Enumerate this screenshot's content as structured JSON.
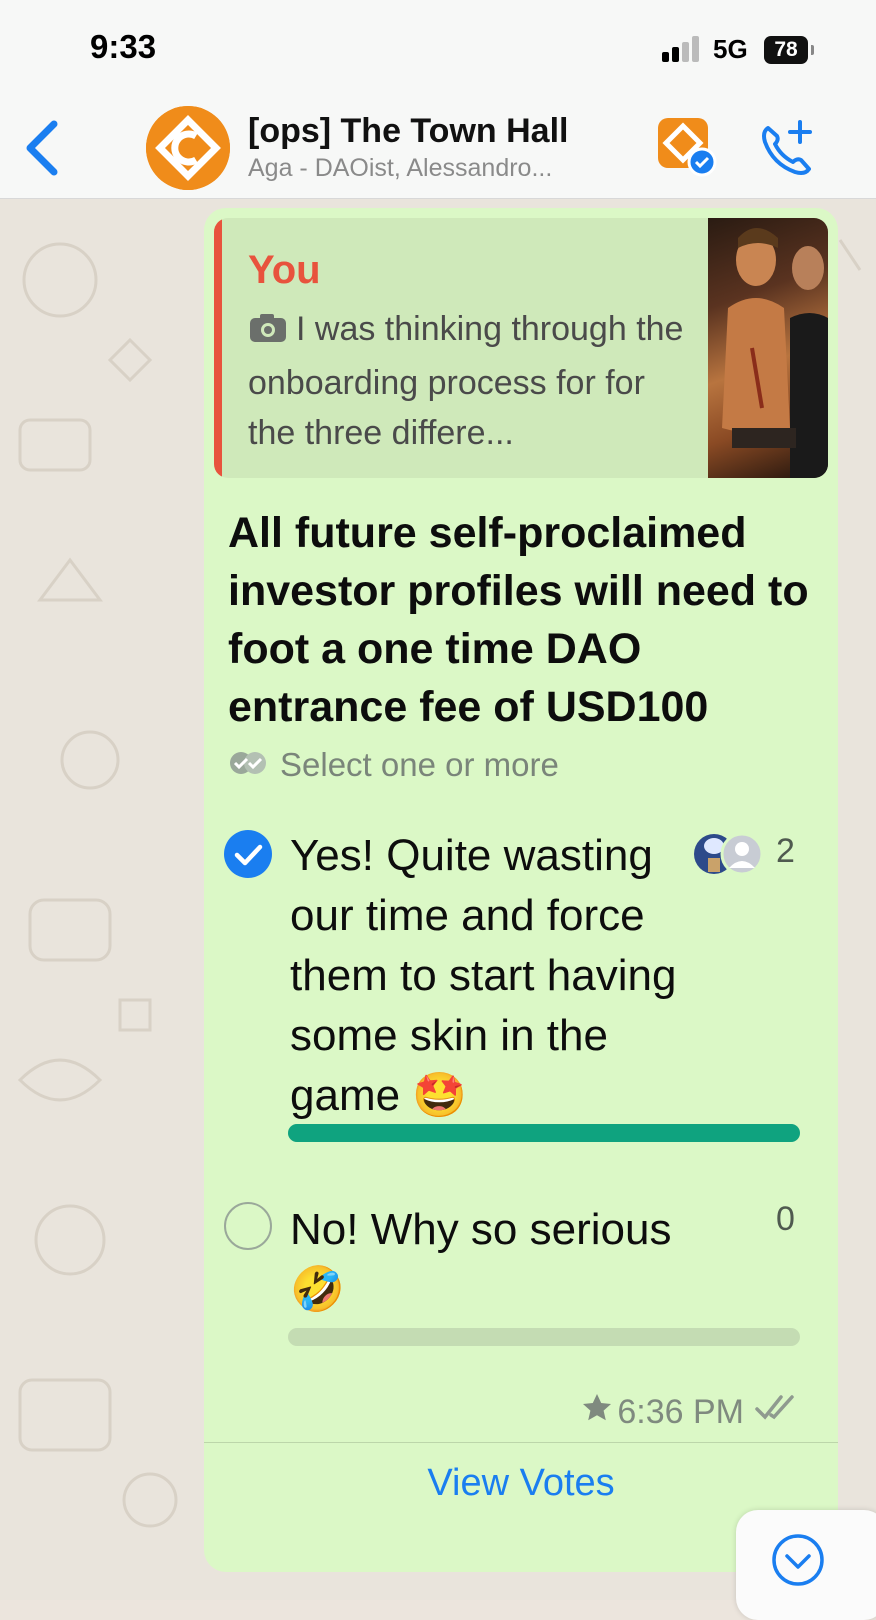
{
  "status_bar": {
    "time": "9:33",
    "network": "5G",
    "battery": "78"
  },
  "header": {
    "group_name": "[ops] The Town Hall",
    "members": "Aga - DAOist, Alessandro...",
    "back_icon": "chevron-left-icon",
    "call_icon": "add-call-icon"
  },
  "message": {
    "quote": {
      "author": "You",
      "text": "I was thinking through the onboarding process for for the three differe..."
    },
    "poll": {
      "question": "All future self-proclaimed investor profiles will need to foot a one time DAO entrance fee of USD100",
      "hint": "Select one or more",
      "options": [
        {
          "label": "Yes! Quite wasting our time and force them to start having some skin in the game 🤩",
          "votes": "2",
          "selected": true,
          "share": 1.0
        },
        {
          "label": "No! Why so serious 🤣",
          "votes": "0",
          "selected": false,
          "share": 0.0
        }
      ]
    },
    "time": "6:36 PM",
    "starred": true,
    "view_votes": "View Votes"
  },
  "colors": {
    "bubble": "#dbf8c6",
    "accent_blue": "#1a7ef0",
    "vote_bar": "#0fa37f",
    "quote_author": "#e8533d"
  }
}
